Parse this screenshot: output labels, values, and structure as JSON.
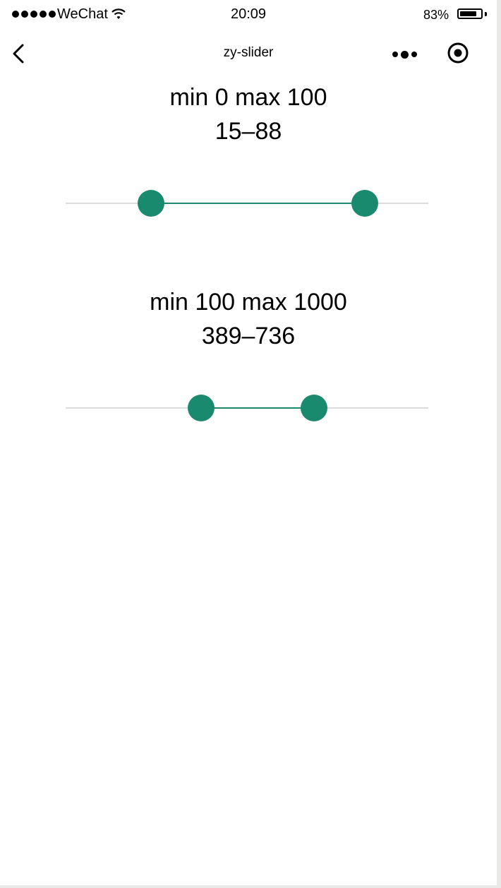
{
  "status_bar": {
    "carrier": "WeChat",
    "time": "20:09",
    "battery_percent": "83%",
    "battery_level": 0.83,
    "icons": [
      "signal-dots-icon",
      "wifi-icon",
      "battery-icon"
    ]
  },
  "nav_bar": {
    "title": "zy-slider",
    "icons": [
      "back-chevron-icon",
      "more-dots-icon",
      "target-circle-icon"
    ]
  },
  "sliders": [
    {
      "range_label": "min 0 max 100",
      "value_label": "15–88",
      "min": 0,
      "max": 100,
      "low": 15,
      "high": 88
    },
    {
      "range_label": "min 100 max 1000",
      "value_label": "389–736",
      "min": 100,
      "max": 1000,
      "low": 389,
      "high": 736
    }
  ],
  "colors": {
    "accent": "#1a8a6e",
    "track": "#dcdcdc",
    "background": "#ffffff"
  }
}
